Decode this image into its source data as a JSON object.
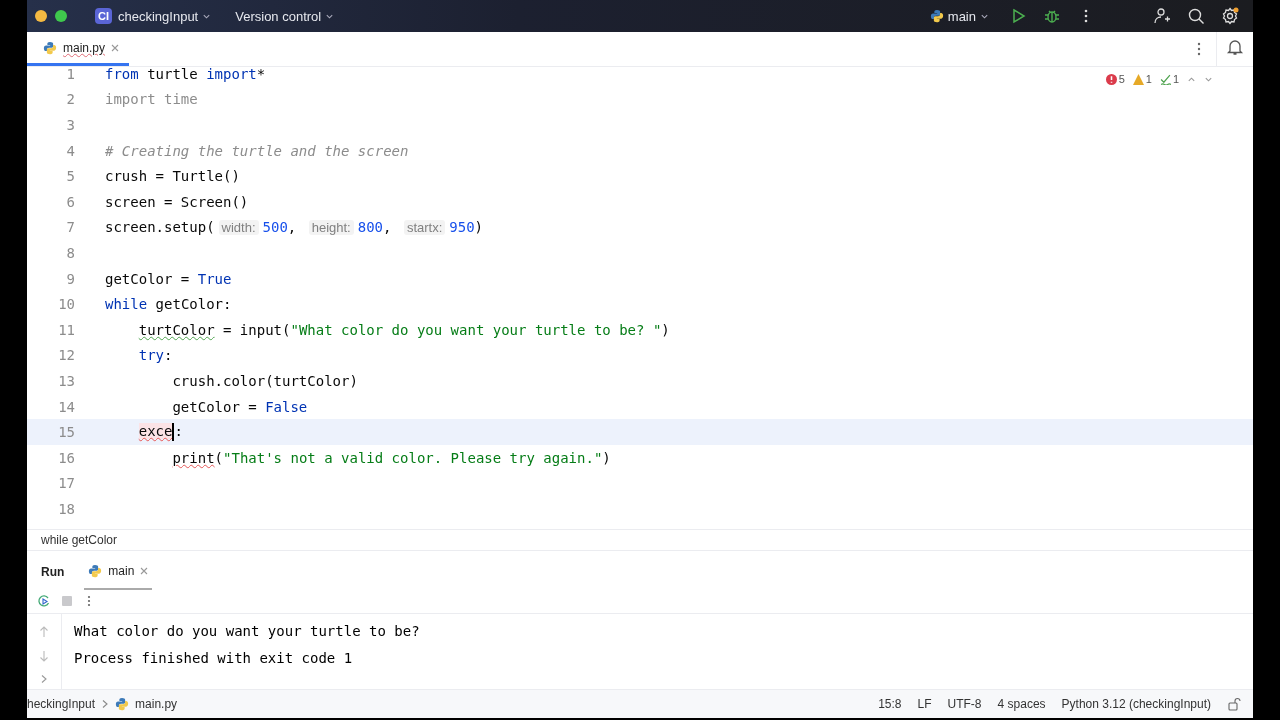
{
  "title_bar": {
    "project_badge": "CI",
    "project": "checkingInput",
    "vcs": "Version control",
    "run_config": "main"
  },
  "editor_tabs": [
    {
      "label": "main.py",
      "selected": true,
      "typo": true
    }
  ],
  "inspections": {
    "errors": "5",
    "warnings": "1",
    "typos": "1"
  },
  "editor": {
    "lines": [
      {
        "number": "1",
        "current": false,
        "caret": false,
        "segments": [
          {
            "text": "from",
            "kind": "keyword"
          },
          {
            "text": " turtle ",
            "kind": "plain"
          },
          {
            "text": "import",
            "kind": "keyword"
          },
          {
            "text": "*",
            "kind": "plain"
          }
        ]
      },
      {
        "number": "2",
        "current": false,
        "caret": false,
        "segments": [
          {
            "text": "import time",
            "kind": "unused"
          }
        ]
      },
      {
        "number": "3",
        "current": false,
        "caret": false
      },
      {
        "number": "4",
        "current": false,
        "caret": false,
        "segments": [
          {
            "text": "# Creating the turtle and the screen",
            "kind": "comment"
          }
        ]
      },
      {
        "number": "5",
        "current": false,
        "caret": false,
        "segments": [
          {
            "text": "crush = Turtle()",
            "kind": "plain"
          }
        ]
      },
      {
        "number": "6",
        "current": false,
        "caret": false,
        "segments": [
          {
            "text": "screen = Screen()",
            "kind": "plain"
          }
        ]
      },
      {
        "number": "7",
        "current": false,
        "caret": false,
        "segments": [
          {
            "text": "screen.setup(",
            "kind": "plain"
          },
          {
            "text": "width:",
            "kind": "hint"
          },
          {
            "text": "500",
            "kind": "number"
          },
          {
            "text": ", ",
            "kind": "plain"
          },
          {
            "text": "height:",
            "kind": "hint"
          },
          {
            "text": "800",
            "kind": "number"
          },
          {
            "text": ", ",
            "kind": "plain"
          },
          {
            "text": "startx:",
            "kind": "hint"
          },
          {
            "text": "950",
            "kind": "number"
          },
          {
            "text": ")",
            "kind": "plain"
          }
        ]
      },
      {
        "number": "8",
        "current": false,
        "caret": false
      },
      {
        "number": "9",
        "current": false,
        "caret": false,
        "segments": [
          {
            "text": "getColor = ",
            "kind": "plain"
          },
          {
            "text": "True",
            "kind": "keyword"
          }
        ]
      },
      {
        "number": "10",
        "current": false,
        "caret": false,
        "segments": [
          {
            "text": "while",
            "kind": "keyword"
          },
          {
            "text": " getColor:",
            "kind": "plain"
          }
        ]
      },
      {
        "number": "11",
        "current": false,
        "caret": false,
        "segments": [
          {
            "text": "    turtColor",
            "kind": "typo"
          },
          {
            "text": " = input(",
            "kind": "plain"
          },
          {
            "text": "\"What color do you want your turtle to be? \"",
            "kind": "string"
          },
          {
            "text": ")",
            "kind": "plain"
          }
        ]
      },
      {
        "number": "12",
        "current": false,
        "caret": false,
        "segments": [
          {
            "text": "    try",
            "kind": "keyword"
          },
          {
            "text": ":",
            "kind": "plain"
          }
        ]
      },
      {
        "number": "13",
        "current": false,
        "caret": false,
        "segments": [
          {
            "text": "        crush.color(turtColor)",
            "kind": "plain"
          }
        ]
      },
      {
        "number": "14",
        "current": false,
        "caret": false,
        "segments": [
          {
            "text": "        getColor = ",
            "kind": "plain"
          },
          {
            "text": "False",
            "kind": "keyword"
          }
        ]
      },
      {
        "number": "15",
        "current": true,
        "caret": true,
        "segments": [
          {
            "text": "    exce",
            "kind": "error"
          },
          {
            "text": ":",
            "kind": "plain"
          }
        ]
      },
      {
        "number": "16",
        "current": false,
        "caret": false,
        "segments": [
          {
            "text": "        print",
            "kind": "error"
          },
          {
            "text": "(",
            "kind": "plain"
          },
          {
            "text": "\"That's not a valid color. Please try again.\"",
            "kind": "string"
          },
          {
            "text": ")",
            "kind": "plain"
          }
        ]
      },
      {
        "number": "17",
        "current": false,
        "caret": false
      },
      {
        "number": "18",
        "current": false,
        "caret": false
      }
    ]
  },
  "breadcrumb": "while getColor",
  "run_panel": {
    "title": "Run",
    "tabs": [
      {
        "label": "main",
        "selected": true
      }
    ],
    "output": [
      "What color do you want your turtle to be?",
      "Process finished with exit code 1"
    ]
  },
  "status_bar": {
    "path": [
      "heckingInput",
      "main.py"
    ],
    "items": [
      "15:8",
      "LF",
      "UTF-8",
      "4 spaces",
      "Python 3.12 (checkingInput)"
    ]
  }
}
